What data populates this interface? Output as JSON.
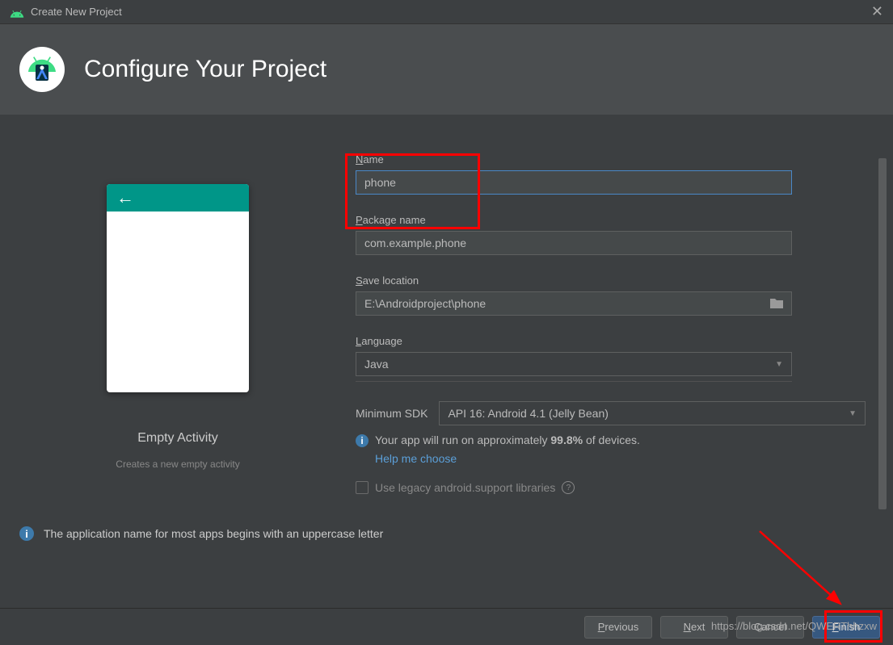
{
  "window": {
    "title": "Create New Project"
  },
  "header": {
    "title": "Configure Your Project"
  },
  "preview": {
    "title": "Empty Activity",
    "subtitle": "Creates a new empty activity"
  },
  "form": {
    "name": {
      "label": "Name",
      "value": "phone"
    },
    "package": {
      "label": "Package name",
      "value": "com.example.phone"
    },
    "location": {
      "label": "Save location",
      "value": "E:\\Androidproject\\phone"
    },
    "language": {
      "label": "Language",
      "value": "Java"
    },
    "sdk": {
      "label": "Minimum SDK",
      "value": "API 16: Android 4.1 (Jelly Bean)"
    },
    "info": {
      "text_pre": "Your app will run on approximately ",
      "percent": "99.8%",
      "text_post": " of devices.",
      "help": "Help me choose"
    },
    "legacy": {
      "label": "Use legacy android.support libraries"
    }
  },
  "hint": {
    "text": "The application name for most apps begins with an uppercase letter"
  },
  "buttons": {
    "previous": "Previous",
    "next": "Next",
    "cancel": "Cancel",
    "finish": "Finish"
  },
  "watermark": "https://blog.csdn.net/QWERThhzxw"
}
